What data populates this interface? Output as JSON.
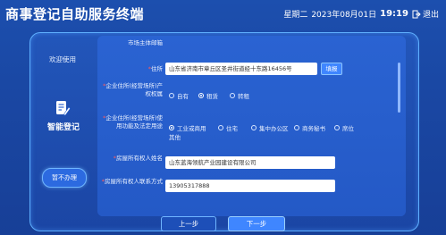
{
  "header": {
    "title": "商事登记自助服务终端",
    "weekday": "星期二",
    "date": "2023年08月01日",
    "time": "19:19",
    "exit_label": "退出"
  },
  "sidebar": {
    "welcome": "欢迎使用",
    "service_icon": "document-edit-icon",
    "service_name": "智能登记",
    "pause_label": "暂不办理"
  },
  "form": {
    "rows": [
      {
        "label": "市场主体邮箱",
        "required": false
      },
      {
        "label": "住所",
        "required": true,
        "value": "山东省济南市章丘区圣井街道经十东路16456号",
        "button": "填报"
      },
      {
        "label": "企业住所(经营场所)产权权属",
        "required": true,
        "options": [
          {
            "label": "自有",
            "selected": false
          },
          {
            "label": "租赁",
            "selected": true
          },
          {
            "label": "转租",
            "selected": false
          }
        ]
      },
      {
        "label": "企业住所(经营场所)使用功能及法定用途",
        "required": true,
        "options": [
          {
            "label": "工业或商用",
            "selected": true
          },
          {
            "label": "住宅",
            "selected": false
          },
          {
            "label": "集中办公区",
            "selected": false
          },
          {
            "label": "商务秘书",
            "selected": false
          },
          {
            "label": "席位",
            "selected": false
          },
          {
            "label": "其他",
            "selected": false
          }
        ]
      },
      {
        "label": "房屋所有权人姓名",
        "required": true,
        "value": "山东蓝海领航产业园建设有限公司"
      },
      {
        "label": "房屋所有权人联系方式",
        "required": true,
        "value": "13905317888"
      }
    ]
  },
  "footer": {
    "prev_label": "上一步",
    "next_label": "下一步"
  },
  "colors": {
    "background": "#1c4fae",
    "accent": "#3f86ff",
    "required": "#ff5a5a"
  }
}
